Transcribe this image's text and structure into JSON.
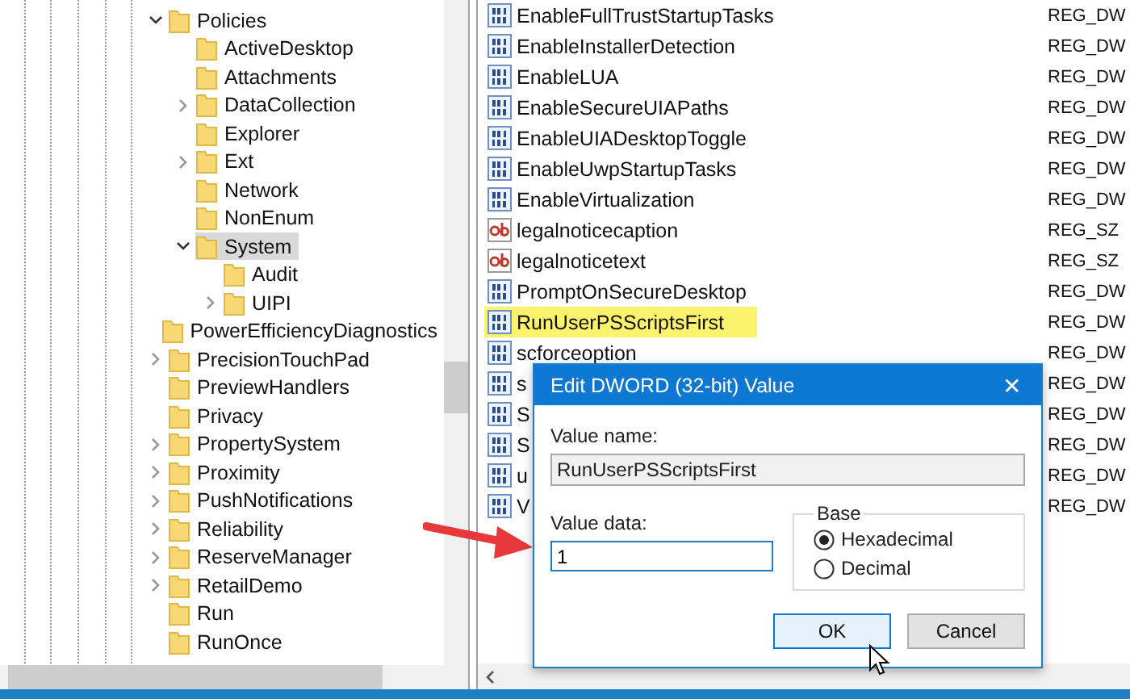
{
  "tree": {
    "items": [
      {
        "label": "Policies",
        "expanded": true,
        "selected": false,
        "children": [
          {
            "label": "ActiveDesktop",
            "selected": false
          },
          {
            "label": "Attachments",
            "selected": false
          },
          {
            "label": "DataCollection",
            "expanded": false,
            "selected": false
          },
          {
            "label": "Explorer",
            "selected": false
          },
          {
            "label": "Ext",
            "expanded": false,
            "selected": false
          },
          {
            "label": "Network",
            "selected": false
          },
          {
            "label": "NonEnum",
            "selected": false
          },
          {
            "label": "System",
            "expanded": true,
            "selected": true,
            "children": [
              {
                "label": "Audit",
                "selected": false
              },
              {
                "label": "UIPI",
                "expanded": false,
                "selected": false
              }
            ]
          }
        ]
      },
      {
        "label": "PowerEfficiencyDiagnostics",
        "selected": false
      },
      {
        "label": "PrecisionTouchPad",
        "expanded": false,
        "selected": false
      },
      {
        "label": "PreviewHandlers",
        "selected": false
      },
      {
        "label": "Privacy",
        "selected": false
      },
      {
        "label": "PropertySystem",
        "expanded": false,
        "selected": false
      },
      {
        "label": "Proximity",
        "expanded": false,
        "selected": false
      },
      {
        "label": "PushNotifications",
        "expanded": false,
        "selected": false
      },
      {
        "label": "Reliability",
        "expanded": false,
        "selected": false
      },
      {
        "label": "ReserveManager",
        "expanded": false,
        "selected": false
      },
      {
        "label": "RetailDemo",
        "expanded": false,
        "selected": false
      },
      {
        "label": "Run",
        "selected": false
      },
      {
        "label": "RunOnce",
        "selected": false
      }
    ]
  },
  "values": [
    {
      "name": "EnableFullTrustStartupTasks",
      "type": "REG_DW",
      "kind": "dword",
      "highlighted": false
    },
    {
      "name": "EnableInstallerDetection",
      "type": "REG_DW",
      "kind": "dword",
      "highlighted": false
    },
    {
      "name": "EnableLUA",
      "type": "REG_DW",
      "kind": "dword",
      "highlighted": false
    },
    {
      "name": "EnableSecureUIAPaths",
      "type": "REG_DW",
      "kind": "dword",
      "highlighted": false
    },
    {
      "name": "EnableUIADesktopToggle",
      "type": "REG_DW",
      "kind": "dword",
      "highlighted": false
    },
    {
      "name": "EnableUwpStartupTasks",
      "type": "REG_DW",
      "kind": "dword",
      "highlighted": false
    },
    {
      "name": "EnableVirtualization",
      "type": "REG_DW",
      "kind": "dword",
      "highlighted": false
    },
    {
      "name": "legalnoticecaption",
      "type": "REG_SZ",
      "kind": "string",
      "highlighted": false
    },
    {
      "name": "legalnoticetext",
      "type": "REG_SZ",
      "kind": "string",
      "highlighted": false
    },
    {
      "name": "PromptOnSecureDesktop",
      "type": "REG_DW",
      "kind": "dword",
      "highlighted": false
    },
    {
      "name": "RunUserPSScriptsFirst",
      "type": "REG_DW",
      "kind": "dword",
      "highlighted": true
    },
    {
      "name": "scforceoption",
      "type": "REG_DW",
      "kind": "dword",
      "highlighted": false
    },
    {
      "name": "s",
      "type": "REG_DW",
      "kind": "dword",
      "highlighted": false
    },
    {
      "name": "S",
      "type": "REG_DW",
      "kind": "dword",
      "highlighted": false
    },
    {
      "name": "S",
      "type": "REG_DW",
      "kind": "dword",
      "highlighted": false
    },
    {
      "name": "u",
      "type": "REG_DW",
      "kind": "dword",
      "highlighted": false
    },
    {
      "name": "V",
      "type": "REG_DW",
      "kind": "dword",
      "highlighted": false
    }
  ],
  "dialog": {
    "title": "Edit DWORD (32-bit) Value",
    "close": "✕",
    "value_name_label": "Value name:",
    "value_name": "RunUserPSScriptsFirst",
    "value_data_label": "Value data:",
    "value_data": "1",
    "base_label": "Base",
    "radios": [
      {
        "label": "Hexadecimal",
        "selected": true
      },
      {
        "label": "Decimal",
        "selected": false
      }
    ],
    "buttons": [
      {
        "label": "OK",
        "focused": true
      },
      {
        "label": "Cancel",
        "focused": false
      }
    ]
  }
}
